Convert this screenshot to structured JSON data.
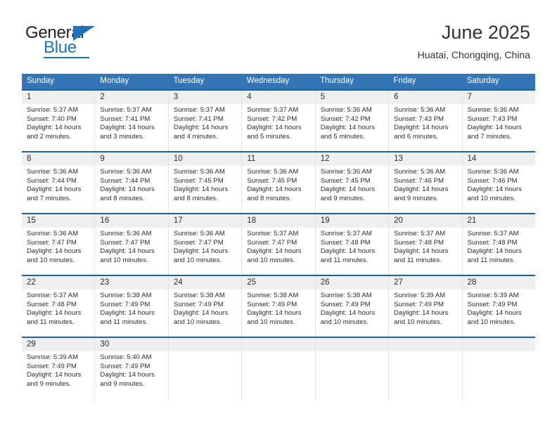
{
  "brand": {
    "name_part1": "General",
    "name_part2": "Blue",
    "flag_icon": "triangle-flag-icon"
  },
  "header": {
    "title": "June 2025",
    "location": "Huatai, Chongqing, China"
  },
  "calendar": {
    "weekday_headers": [
      "Sunday",
      "Monday",
      "Tuesday",
      "Wednesday",
      "Thursday",
      "Friday",
      "Saturday"
    ],
    "colors": {
      "header_blue": "#3476b5",
      "row_border_blue": "#1f5fa0",
      "day_band_gray": "#efefef",
      "brand_blue": "#1b75bb"
    },
    "weeks": [
      [
        {
          "day": "1",
          "sunrise": "Sunrise: 5:37 AM",
          "sunset": "Sunset: 7:40 PM",
          "daylight": "Daylight: 14 hours and 2 minutes."
        },
        {
          "day": "2",
          "sunrise": "Sunrise: 5:37 AM",
          "sunset": "Sunset: 7:41 PM",
          "daylight": "Daylight: 14 hours and 3 minutes."
        },
        {
          "day": "3",
          "sunrise": "Sunrise: 5:37 AM",
          "sunset": "Sunset: 7:41 PM",
          "daylight": "Daylight: 14 hours and 4 minutes."
        },
        {
          "day": "4",
          "sunrise": "Sunrise: 5:37 AM",
          "sunset": "Sunset: 7:42 PM",
          "daylight": "Daylight: 14 hours and 5 minutes."
        },
        {
          "day": "5",
          "sunrise": "Sunrise: 5:36 AM",
          "sunset": "Sunset: 7:42 PM",
          "daylight": "Daylight: 14 hours and 5 minutes."
        },
        {
          "day": "6",
          "sunrise": "Sunrise: 5:36 AM",
          "sunset": "Sunset: 7:43 PM",
          "daylight": "Daylight: 14 hours and 6 minutes."
        },
        {
          "day": "7",
          "sunrise": "Sunrise: 5:36 AM",
          "sunset": "Sunset: 7:43 PM",
          "daylight": "Daylight: 14 hours and 7 minutes."
        }
      ],
      [
        {
          "day": "8",
          "sunrise": "Sunrise: 5:36 AM",
          "sunset": "Sunset: 7:44 PM",
          "daylight": "Daylight: 14 hours and 7 minutes."
        },
        {
          "day": "9",
          "sunrise": "Sunrise: 5:36 AM",
          "sunset": "Sunset: 7:44 PM",
          "daylight": "Daylight: 14 hours and 8 minutes."
        },
        {
          "day": "10",
          "sunrise": "Sunrise: 5:36 AM",
          "sunset": "Sunset: 7:45 PM",
          "daylight": "Daylight: 14 hours and 8 minutes."
        },
        {
          "day": "11",
          "sunrise": "Sunrise: 5:36 AM",
          "sunset": "Sunset: 7:45 PM",
          "daylight": "Daylight: 14 hours and 8 minutes."
        },
        {
          "day": "12",
          "sunrise": "Sunrise: 5:36 AM",
          "sunset": "Sunset: 7:45 PM",
          "daylight": "Daylight: 14 hours and 9 minutes."
        },
        {
          "day": "13",
          "sunrise": "Sunrise: 5:36 AM",
          "sunset": "Sunset: 7:46 PM",
          "daylight": "Daylight: 14 hours and 9 minutes."
        },
        {
          "day": "14",
          "sunrise": "Sunrise: 5:36 AM",
          "sunset": "Sunset: 7:46 PM",
          "daylight": "Daylight: 14 hours and 10 minutes."
        }
      ],
      [
        {
          "day": "15",
          "sunrise": "Sunrise: 5:36 AM",
          "sunset": "Sunset: 7:47 PM",
          "daylight": "Daylight: 14 hours and 10 minutes."
        },
        {
          "day": "16",
          "sunrise": "Sunrise: 5:36 AM",
          "sunset": "Sunset: 7:47 PM",
          "daylight": "Daylight: 14 hours and 10 minutes."
        },
        {
          "day": "17",
          "sunrise": "Sunrise: 5:36 AM",
          "sunset": "Sunset: 7:47 PM",
          "daylight": "Daylight: 14 hours and 10 minutes."
        },
        {
          "day": "18",
          "sunrise": "Sunrise: 5:37 AM",
          "sunset": "Sunset: 7:47 PM",
          "daylight": "Daylight: 14 hours and 10 minutes."
        },
        {
          "day": "19",
          "sunrise": "Sunrise: 5:37 AM",
          "sunset": "Sunset: 7:48 PM",
          "daylight": "Daylight: 14 hours and 11 minutes."
        },
        {
          "day": "20",
          "sunrise": "Sunrise: 5:37 AM",
          "sunset": "Sunset: 7:48 PM",
          "daylight": "Daylight: 14 hours and 11 minutes."
        },
        {
          "day": "21",
          "sunrise": "Sunrise: 5:37 AM",
          "sunset": "Sunset: 7:48 PM",
          "daylight": "Daylight: 14 hours and 11 minutes."
        }
      ],
      [
        {
          "day": "22",
          "sunrise": "Sunrise: 5:37 AM",
          "sunset": "Sunset: 7:48 PM",
          "daylight": "Daylight: 14 hours and 11 minutes."
        },
        {
          "day": "23",
          "sunrise": "Sunrise: 5:38 AM",
          "sunset": "Sunset: 7:49 PM",
          "daylight": "Daylight: 14 hours and 11 minutes."
        },
        {
          "day": "24",
          "sunrise": "Sunrise: 5:38 AM",
          "sunset": "Sunset: 7:49 PM",
          "daylight": "Daylight: 14 hours and 10 minutes."
        },
        {
          "day": "25",
          "sunrise": "Sunrise: 5:38 AM",
          "sunset": "Sunset: 7:49 PM",
          "daylight": "Daylight: 14 hours and 10 minutes."
        },
        {
          "day": "26",
          "sunrise": "Sunrise: 5:38 AM",
          "sunset": "Sunset: 7:49 PM",
          "daylight": "Daylight: 14 hours and 10 minutes."
        },
        {
          "day": "27",
          "sunrise": "Sunrise: 5:39 AM",
          "sunset": "Sunset: 7:49 PM",
          "daylight": "Daylight: 14 hours and 10 minutes."
        },
        {
          "day": "28",
          "sunrise": "Sunrise: 5:39 AM",
          "sunset": "Sunset: 7:49 PM",
          "daylight": "Daylight: 14 hours and 10 minutes."
        }
      ],
      [
        {
          "day": "29",
          "sunrise": "Sunrise: 5:39 AM",
          "sunset": "Sunset: 7:49 PM",
          "daylight": "Daylight: 14 hours and 9 minutes."
        },
        {
          "day": "30",
          "sunrise": "Sunrise: 5:40 AM",
          "sunset": "Sunset: 7:49 PM",
          "daylight": "Daylight: 14 hours and 9 minutes."
        },
        {
          "day": "",
          "sunrise": "",
          "sunset": "",
          "daylight": ""
        },
        {
          "day": "",
          "sunrise": "",
          "sunset": "",
          "daylight": ""
        },
        {
          "day": "",
          "sunrise": "",
          "sunset": "",
          "daylight": ""
        },
        {
          "day": "",
          "sunrise": "",
          "sunset": "",
          "daylight": ""
        },
        {
          "day": "",
          "sunrise": "",
          "sunset": "",
          "daylight": ""
        }
      ]
    ]
  }
}
